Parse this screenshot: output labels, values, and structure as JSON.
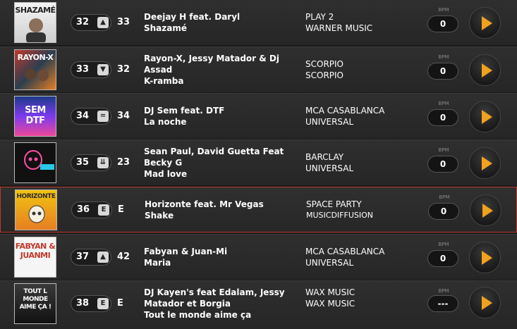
{
  "colors": {
    "accent": "#f0a11e",
    "highlight_border": "#c0392b"
  },
  "bpm_label": "BPM",
  "rows": [
    {
      "position": "32",
      "trend": "▲",
      "previous": "33",
      "artist_line1": "Deejay H feat. Daryl",
      "artist_line2": "",
      "song": "Shazamé",
      "label": "PLAY 2",
      "distributor": "WARNER MUSIC",
      "bpm": "0",
      "cover_text": "SHAZAMÉ",
      "cover_icon": "artist-photo-icon"
    },
    {
      "position": "33",
      "trend": "▼",
      "previous": "32",
      "artist_line1": "Rayon-X, Jessy Matador & Dj",
      "artist_line2": "Assad",
      "song": "K-ramba",
      "label": "SCORPIO",
      "distributor": "SCORPIO",
      "bpm": "0",
      "cover_text": "RAYON-X",
      "cover_icon": "artist-photo-icon"
    },
    {
      "position": "34",
      "trend": "=",
      "previous": "34",
      "artist_line1": "DJ Sem feat. DTF",
      "artist_line2": "",
      "song": "La noche",
      "label": "MCA CASABLANCA",
      "distributor": "UNIVERSAL",
      "bpm": "0",
      "cover_text": "SEM DTF",
      "cover_icon": "album-art-icon"
    },
    {
      "position": "35",
      "trend": "⇊",
      "previous": "23",
      "artist_line1": "Sean Paul, David Guetta Feat",
      "artist_line2": "Becky G",
      "song": "Mad love",
      "label": "BARCLAY",
      "distributor": "UNIVERSAL",
      "bpm": "0",
      "cover_text": "",
      "cover_icon": "neon-skull-icon"
    },
    {
      "position": "36",
      "trend": "E",
      "previous": "E",
      "artist_line1": "Horizonte feat. Mr Vegas",
      "artist_line2": "",
      "song": "Shake",
      "label": "SPACE PARTY",
      "distributor": "MUSICDIFFUSION",
      "bpm": "0",
      "cover_text": "HORIZONTE",
      "cover_icon": "skull-icon"
    },
    {
      "position": "37",
      "trend": "▲",
      "previous": "42",
      "artist_line1": "Fabyan & Juan-Mi",
      "artist_line2": "",
      "song": "Maria",
      "label": "MCA CASABLANCA",
      "distributor": "UNIVERSAL",
      "bpm": "0",
      "cover_text": "FABYAN & JUANMI",
      "cover_icon": "album-art-icon"
    },
    {
      "position": "38",
      "trend": "E",
      "previous": "E",
      "artist_line1": "DJ Kayen's feat Edalam, Jessy",
      "artist_line2": "Matador et Borgia",
      "song": "Tout le monde aime ça",
      "label": "WAX MUSIC",
      "distributor": "WAX MUSIC",
      "bpm": "---",
      "cover_text": "TOUT L MONDE AIME ÇA !",
      "cover_icon": "album-art-icon"
    }
  ]
}
